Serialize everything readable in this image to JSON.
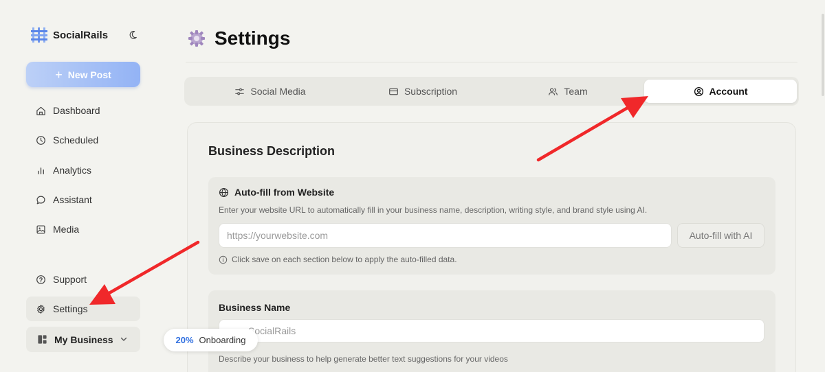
{
  "brand": {
    "name": "SocialRails"
  },
  "sidebar": {
    "new_post_label": "New Post",
    "nav": [
      {
        "label": "Dashboard",
        "icon": "home-icon"
      },
      {
        "label": "Scheduled",
        "icon": "clock-icon"
      },
      {
        "label": "Analytics",
        "icon": "bar-chart-icon"
      },
      {
        "label": "Assistant",
        "icon": "chat-icon"
      },
      {
        "label": "Media",
        "icon": "image-icon"
      }
    ],
    "support_label": "Support",
    "settings_label": "Settings",
    "business_label": "My Business"
  },
  "onboarding": {
    "percent": "20%",
    "label": "Onboarding"
  },
  "page": {
    "title": "Settings"
  },
  "tabs": [
    {
      "label": "Social Media",
      "icon": "sliders-icon"
    },
    {
      "label": "Subscription",
      "icon": "credit-card-icon"
    },
    {
      "label": "Team",
      "icon": "users-icon"
    },
    {
      "label": "Account",
      "icon": "user-circle-icon",
      "active": true
    }
  ],
  "business_description": {
    "section_title": "Business Description",
    "autofill": {
      "title": "Auto-fill from Website",
      "description": "Enter your website URL to automatically fill in your business name, description, writing style, and brand style using AI.",
      "url_placeholder": "https://yourwebsite.com",
      "button_label": "Auto-fill with AI",
      "note": "Click save on each section below to apply the auto-filled data."
    },
    "business_name": {
      "label": "Business Name",
      "value": "SocialRails",
      "help": "Describe your business to help generate better text suggestions for your videos"
    }
  },
  "colors": {
    "accent": "#2f6fe0",
    "new_post_gradient_start": "#bcd0f7",
    "new_post_gradient_end": "#93b3f5",
    "annotation_arrow": "#f0282a"
  }
}
